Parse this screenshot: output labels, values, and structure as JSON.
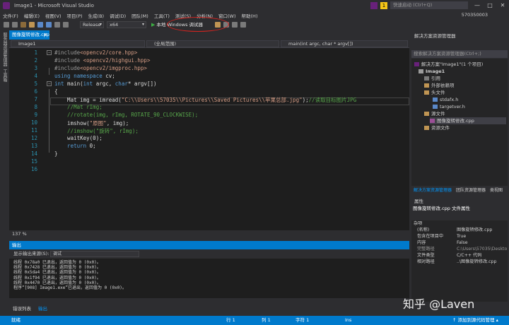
{
  "window": {
    "title": "Image1 - Microsoft Visual Studio",
    "quick_launch": "快速启动 (Ctrl+Q)",
    "notif_count": "1"
  },
  "menu": [
    "文件(F)",
    "编辑(E)",
    "视图(V)",
    "项目(P)",
    "生成(B)",
    "调试(D)",
    "团队(M)",
    "工具(T)",
    "测试(S)",
    "分析(N)",
    "窗口(W)",
    "帮助(H)"
  ],
  "account": "570350003",
  "toolbar": {
    "config": "Release",
    "platform": "x64",
    "run_label": "本地 Windows 调试器"
  },
  "left_strip": {
    "tab1": "服务器资源管理器",
    "tab2": "工具箱"
  },
  "editor": {
    "tab_label": "图像旋转修改.cpp",
    "nav_project": "Image1",
    "nav_scope": "(全局范围)",
    "nav_member": "main(int argc, char * argv[])",
    "lines": [
      "1",
      "2",
      "3",
      "4",
      "5",
      "6",
      "7",
      "8",
      "9",
      "10",
      "11",
      "12",
      "13",
      "14",
      "15",
      "16"
    ],
    "code": {
      "l1a": "#include",
      "l1b": "<opencv2/core.hpp>",
      "l2a": "#include ",
      "l2b": "<opencv2/highgui.hpp>",
      "l3a": "#include",
      "l3b": "<opencv2/imgproc.hpp>",
      "l4a": "using namespace",
      "l4b": " cv;",
      "l5a": "int",
      "l5b": " main(",
      "l5c": "int",
      "l5d": " argc, ",
      "l5e": "char",
      "l5f": "* argv[])",
      "l6": "{",
      "l7a": "    Mat img = imread(",
      "l7b": "\"C:\\\\Users\\\\57035\\\\Pictures\\\\Saved Pictures\\\\苹果总部.jpg\"",
      "l7c": ");",
      "l7d": "//读取目标图片JPG",
      "l8": "    //Mat rImg;",
      "l9": "    //rotate(img, rImg, ROTATE_90_CLOCKWISE);",
      "l10a": "    imshow(",
      "l10b": "\"原图\"",
      "l10c": ", img);",
      "l11": "    //imshow(\"旋转\", rImg);",
      "l12": "    waitKey(0);",
      "l13a": "    return",
      "l13b": " 0;",
      "l14": "}"
    },
    "zoom": "137 %"
  },
  "output": {
    "title": "输出",
    "source_label": "显示输出来源(S):",
    "source_value": "调试",
    "lines": [
      "线程 0x78a0 已退出，返回值为 0 (0x0)。",
      "线程 0x7428 已退出，返回值为 0 (0x0)。",
      "线程 0x5da4 已退出，返回值为 0 (0x0)。",
      "线程 0x1f94 已退出，返回值为 0 (0x0)。",
      "线程 0x4470 已退出，返回值为 0 (0x0)。",
      "程序“[908] Image1.exe”已退出，返回值为 0 (0x0)。"
    ]
  },
  "bottom_tabs": [
    "错误列表",
    "输出"
  ],
  "solution_explorer": {
    "title": "解决方案资源管理器",
    "search": "搜索解决方案资源管理器(Ctrl+;)",
    "tree": [
      {
        "label": "解决方案\"Image1\"(1 个项目)",
        "indent": 0
      },
      {
        "label": "Image1",
        "indent": 1
      },
      {
        "label": "引用",
        "indent": 2
      },
      {
        "label": "外部依赖项",
        "indent": 2
      },
      {
        "label": "头文件",
        "indent": 2
      },
      {
        "label": "stdafx.h",
        "indent": 3
      },
      {
        "label": "targetver.h",
        "indent": 3
      },
      {
        "label": "源文件",
        "indent": 2
      },
      {
        "label": "图像旋转修改.cpp",
        "indent": 3
      },
      {
        "label": "资源文件",
        "indent": 2
      }
    ],
    "tabs": [
      "解决方案资源管理器",
      "团队资源管理器",
      "类视图"
    ]
  },
  "properties": {
    "title": "属性",
    "subject": "图像旋转修改.cpp 文件属性",
    "section": "杂项",
    "rows": [
      {
        "k": "(名称)",
        "v": "图像旋转修改.cpp",
        "dim": false
      },
      {
        "k": "包含在项目中",
        "v": "True",
        "dim": false
      },
      {
        "k": "内容",
        "v": "False",
        "dim": false
      },
      {
        "k": "完整路径",
        "v": "C:\\Users\\57035\\Deskto",
        "dim": true
      },
      {
        "k": "文件类型",
        "v": "C/C++ 代码",
        "dim": false
      },
      {
        "k": "相对路径",
        "v": "..\\图像旋转修改.cpp",
        "dim": false
      }
    ]
  },
  "status": {
    "ready": "就绪",
    "row": "行 1",
    "col": "列 1",
    "char": "字符 1",
    "ins": "Ins",
    "source_control": "↑ 添加到源代码管理 ▴"
  },
  "watermark": "知乎 @Laven",
  "colors": {
    "accent": "#007acc",
    "background": "#1e1e1e",
    "run_highlight": "#d9231e"
  }
}
